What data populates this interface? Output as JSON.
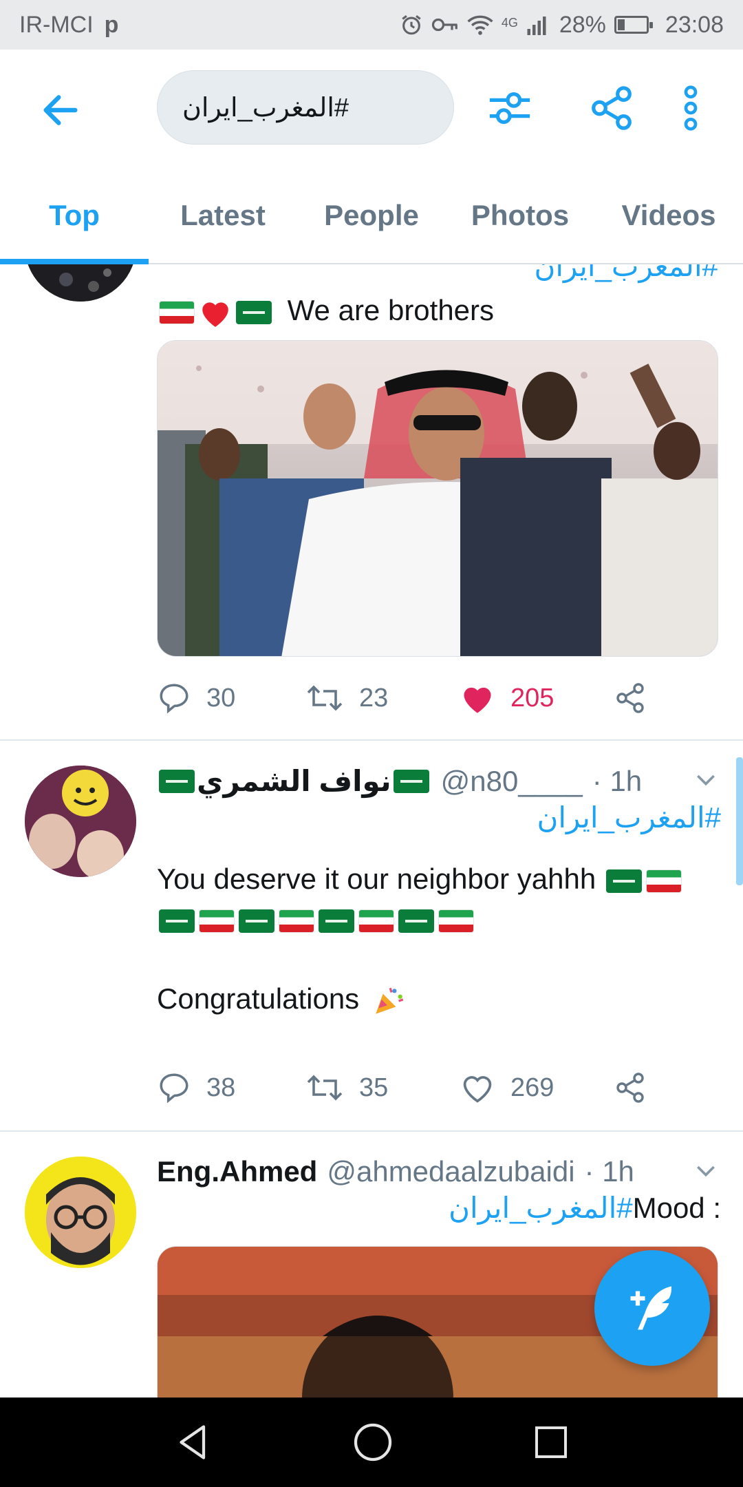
{
  "status_bar": {
    "carrier": "IR-MCI",
    "carrier_icon": "p",
    "network": "4G",
    "battery": "28%",
    "time": "23:08"
  },
  "search": {
    "query": "#المغرب_ايران"
  },
  "tabs": [
    {
      "label": "Top",
      "active": true
    },
    {
      "label": "Latest"
    },
    {
      "label": "People"
    },
    {
      "label": "Photos"
    },
    {
      "label": "Videos"
    }
  ],
  "tweets": [
    {
      "hashtag": "#المغرب_ايران",
      "text": "We are brothers",
      "replies": "30",
      "retweets": "23",
      "likes": "205",
      "liked": true
    },
    {
      "name": "نواف الشمري",
      "handle": "@n80____",
      "time": "· 1h",
      "hashtag": "#المغرب_ايران",
      "text_line1": "You deserve it our neighbor yahhh",
      "text_line2": "Congratulations",
      "replies": "38",
      "retweets": "35",
      "likes": "269",
      "liked": false
    },
    {
      "name": "Eng.Ahmed",
      "handle": "@ahmedaalzubaidi",
      "time": "· 1h",
      "hashtag": "#المغرب_ايران",
      "text_prefix": "Mood :"
    }
  ],
  "colors": {
    "accent": "#1da1f2",
    "like": "#e0245e",
    "muted": "#657786"
  }
}
